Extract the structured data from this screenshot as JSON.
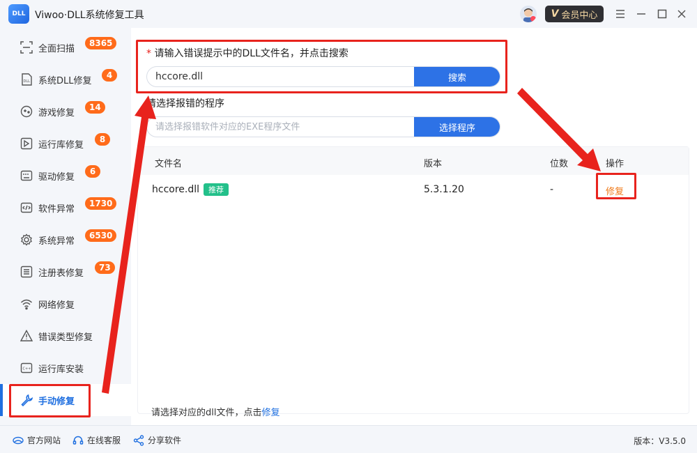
{
  "window": {
    "title": "Viwoo·DLL系统修复工具",
    "logo_text": "DLL",
    "vip_label": "会员中心",
    "vip_letter": "V"
  },
  "sidebar": {
    "items": [
      {
        "label": "全面扫描",
        "badge": "8365"
      },
      {
        "label": "系统DLL修复",
        "badge": "4"
      },
      {
        "label": "游戏修复",
        "badge": "14"
      },
      {
        "label": "运行库修复",
        "badge": "8"
      },
      {
        "label": "驱动修复",
        "badge": "6"
      },
      {
        "label": "软件异常",
        "badge": "1730"
      },
      {
        "label": "系统异常",
        "badge": "6530"
      },
      {
        "label": "注册表修复",
        "badge": "73"
      },
      {
        "label": "网络修复"
      },
      {
        "label": "错误类型修复"
      },
      {
        "label": "运行库安装"
      },
      {
        "label": "手动修复"
      }
    ]
  },
  "search": {
    "required_mark": "*",
    "label": "请输入错误提示中的DLL文件名，并点击搜索",
    "value": "hccore.dll",
    "button": "搜索"
  },
  "program": {
    "label": "请选择报错的程序",
    "placeholder": "请选择报错软件对应的EXE程序文件",
    "button": "选择程序"
  },
  "table": {
    "headers": [
      "文件名",
      "版本",
      "位数",
      "操作"
    ],
    "rows": [
      {
        "filename": "hccore.dll",
        "tag": "推荐",
        "version": "5.3.1.20",
        "bits": "-",
        "action": "修复"
      }
    ]
  },
  "hint": {
    "text": "请选择对应的dll文件，点击",
    "link": "修复"
  },
  "footer": {
    "website": "官方网站",
    "service": "在线客服",
    "share": "分享软件",
    "version": "版本：V3.5.0"
  },
  "colors": {
    "accent": "#2d72e6",
    "badge": "#ff6b1a",
    "highlight": "#e8231d",
    "tag": "#23c08a",
    "action": "#f07b1b"
  }
}
